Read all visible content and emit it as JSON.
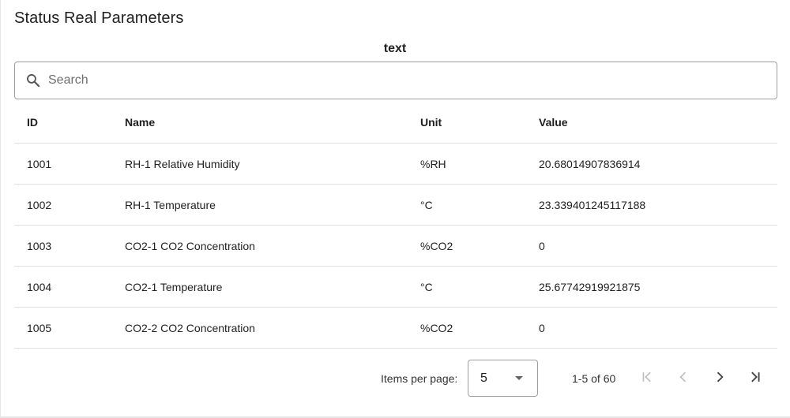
{
  "page": {
    "title": "Status Real Parameters",
    "section_label": "text"
  },
  "search": {
    "placeholder": "Search",
    "value": ""
  },
  "table": {
    "columns": [
      "ID",
      "Name",
      "Unit",
      "Value"
    ],
    "rows": [
      [
        "1001",
        "RH-1 Relative Humidity",
        "%RH",
        "20.68014907836914"
      ],
      [
        "1002",
        "RH-1 Temperature",
        "°C",
        "23.339401245117188"
      ],
      [
        "1003",
        "CO2-1 CO2 Concentration",
        "%CO2",
        "0"
      ],
      [
        "1004",
        "CO2-1 Temperature",
        "°C",
        "25.67742919921875"
      ],
      [
        "1005",
        "CO2-2 CO2 Concentration",
        "%CO2",
        "0"
      ]
    ]
  },
  "paginator": {
    "items_per_page_label": "Items per page:",
    "items_per_page": "5",
    "range_label": "1-5 of 60",
    "first_enabled": false,
    "prev_enabled": false,
    "next_enabled": true,
    "last_enabled": true
  },
  "icons": {
    "search": "search-icon",
    "dropdown": "arrow-drop-down-icon",
    "first": "first-page-icon",
    "prev": "chevron-left-icon",
    "next": "chevron-right-icon",
    "last": "last-page-icon"
  },
  "colors": {
    "disabled_icon": "#bdbdbd",
    "enabled_icon": "#424242",
    "border": "#9e9e9e",
    "divider": "#e0e0e0"
  }
}
